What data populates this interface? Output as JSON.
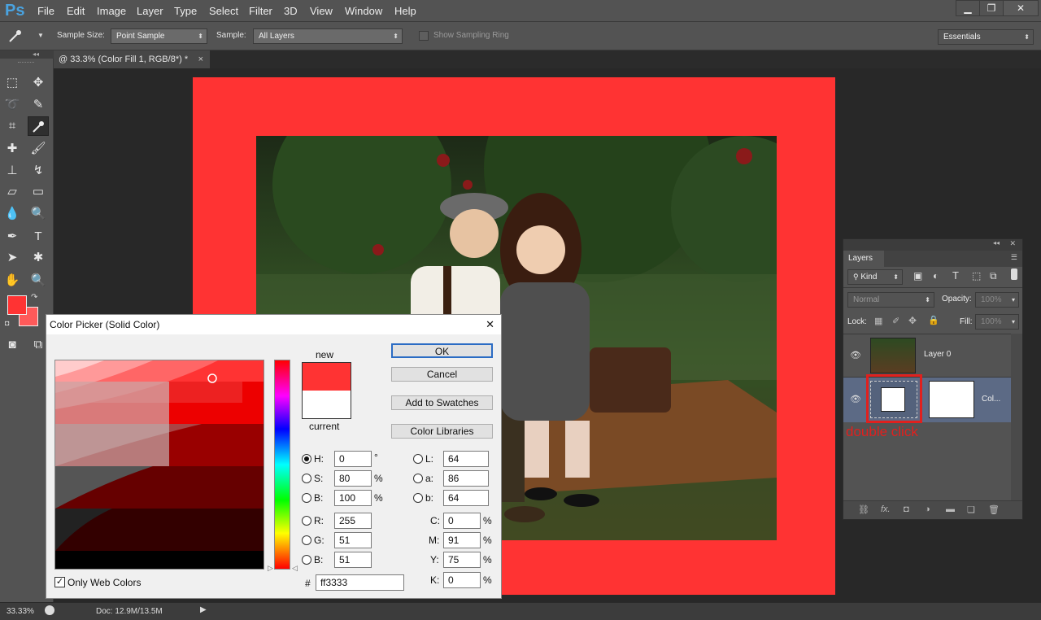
{
  "app": {
    "logo": "Ps"
  },
  "menu": [
    "File",
    "Edit",
    "Image",
    "Layer",
    "Type",
    "Select",
    "Filter",
    "3D",
    "View",
    "Window",
    "Help"
  ],
  "window_controls": {
    "minimize": "▁",
    "restore": "❐",
    "close": "✕"
  },
  "options": {
    "sample_size_label": "Sample Size:",
    "sample_size_value": "Point Sample",
    "sample_label": "Sample:",
    "sample_value": "All Layers",
    "sampling_ring_label": "Show Sampling Ring",
    "workspace": "Essentials"
  },
  "document": {
    "tab_title": "@ 33.3% (Color Fill 1, RGB/8*) *",
    "tab_close": "×",
    "fill_color": "#ff3333"
  },
  "status": {
    "zoom": "33.33%",
    "doc": "Doc: 12.9M/13.5M"
  },
  "layers_panel": {
    "title": "Layers",
    "kind": "Kind",
    "blend_mode": "Normal",
    "opacity_label": "Opacity:",
    "opacity_value": "100%",
    "lock_label": "Lock:",
    "fill_label": "Fill:",
    "fill_value": "100%",
    "layers": [
      {
        "name": "Layer 0"
      },
      {
        "name": "Col..."
      }
    ],
    "annotation": "double click",
    "annotation_color": "#e0201e"
  },
  "color_picker": {
    "title": "Color Picker (Solid Color)",
    "close": "✕",
    "new_label": "new",
    "current_label": "current",
    "new_color": "#ff3333",
    "current_color": "#ffffff",
    "buttons": {
      "ok": "OK",
      "cancel": "Cancel",
      "add_swatches": "Add to Swatches",
      "color_libraries": "Color Libraries"
    },
    "hsb": {
      "h_label": "H:",
      "h": "0",
      "h_unit": "°",
      "s_label": "S:",
      "s": "80",
      "s_unit": "%",
      "b_label": "B:",
      "b": "100",
      "b_unit": "%"
    },
    "rgb": {
      "r_label": "R:",
      "r": "255",
      "g_label": "G:",
      "g": "51",
      "b_label": "B:",
      "b": "51"
    },
    "lab": {
      "l_label": "L:",
      "l": "64",
      "a_label": "a:",
      "a": "86",
      "b_label": "b:",
      "b": "64"
    },
    "cmyk": {
      "c_label": "C:",
      "c": "0",
      "m_label": "M:",
      "m": "91",
      "y_label": "Y:",
      "y": "75",
      "k_label": "K:",
      "k": "0",
      "unit": "%"
    },
    "hex_label": "#",
    "hex": "ff3333",
    "web_colors_label": "Only Web Colors"
  }
}
